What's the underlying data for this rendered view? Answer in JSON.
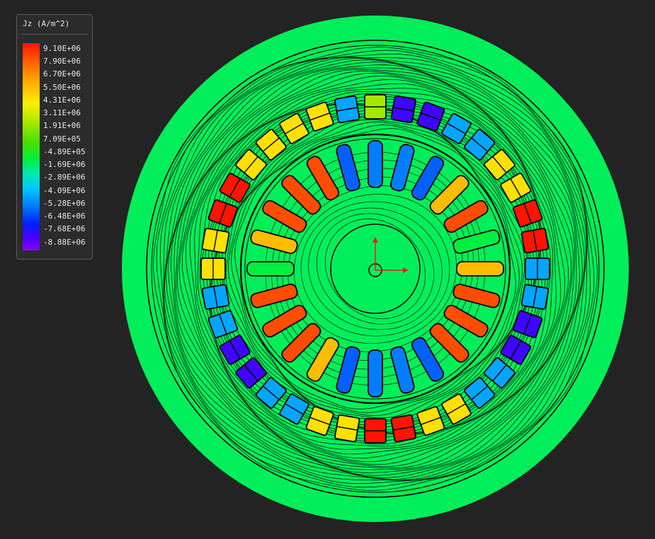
{
  "legend": {
    "title": "Jz (A/m^2)",
    "labels": [
      "9.10E+06",
      "7.90E+06",
      "6.70E+06",
      "5.50E+06",
      "4.31E+06",
      "3.11E+06",
      "1.91E+06",
      "7.09E+05",
      "-4.89E+05",
      "-1.69E+06",
      "-2.89E+06",
      "-4.09E+06",
      "-5.28E+06",
      "-6.48E+06",
      "-7.68E+06",
      "-8.88E+06"
    ],
    "min": -8880000.0,
    "max": 9100000.0
  },
  "colors": {
    "background": "#232323",
    "stator_fill": "#00ee5a",
    "flux_line": "#000000",
    "axis_x": "#e0202a",
    "axis_y": "#e0202a"
  },
  "model": {
    "outer_slots": 36,
    "inner_slots": 24,
    "outer_conductor_jz": [
      2200000.0,
      -7600000.0,
      -7600000.0,
      -4200000.0,
      -4200000.0,
      4300000.0,
      4300000.0,
      9100000.0,
      9100000.0,
      -4200000.0,
      -4200000.0,
      -7600000.0,
      -7600000.0,
      -4200000.0,
      -4200000.0,
      4300000.0,
      4300000.0,
      9100000.0,
      9100000.0,
      4300000.0,
      4300000.0,
      -4200000.0,
      -4200000.0,
      -7600000.0,
      -7600000.0,
      -4200000.0,
      -4200000.0,
      4300000.0,
      4300000.0,
      9100000.0,
      9100000.0,
      4300000.0,
      4300000.0,
      4300000.0,
      4300000.0,
      -4200000.0
    ],
    "inner_conductor_jz": [
      7900000.0,
      -1000000.0,
      5300000.0,
      7900000.0,
      7900000.0,
      7900000.0,
      -5500000.0,
      -5000000.0,
      -5000000.0,
      -5500000.0,
      5300000.0,
      7900000.0,
      7900000.0,
      7900000.0,
      -1000000.0,
      5300000.0,
      7900000.0,
      7900000.0,
      7900000.0,
      -5500000.0,
      -5000000.0,
      -5000000.0,
      -5500000.0,
      5300000.0
    ]
  }
}
